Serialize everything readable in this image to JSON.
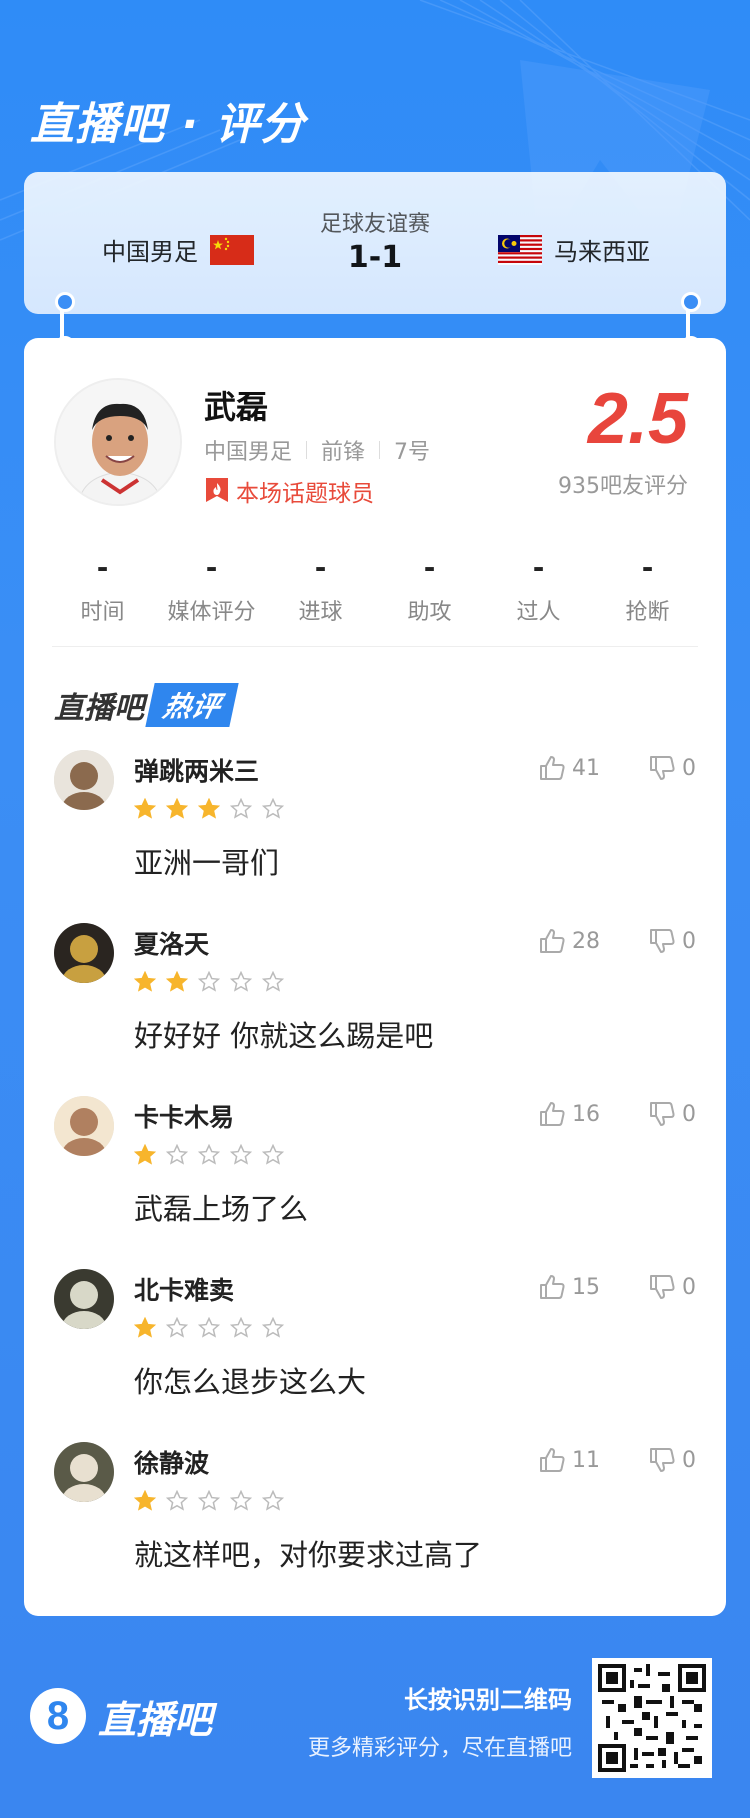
{
  "header": {
    "title": "直播吧 · 评分"
  },
  "match": {
    "home_team": "中国男足",
    "away_team": "马来西亚",
    "type": "足球友谊赛",
    "score": "1-1"
  },
  "player": {
    "name": "武磊",
    "team": "中国男足",
    "position": "前锋",
    "number": "7号",
    "badge": "本场话题球员",
    "rating": "2.5",
    "rating_count": "935吧友评分"
  },
  "stats": [
    {
      "label": "时间",
      "value": "-"
    },
    {
      "label": "媒体评分",
      "value": "-"
    },
    {
      "label": "进球",
      "value": "-"
    },
    {
      "label": "助攻",
      "value": "-"
    },
    {
      "label": "过人",
      "value": "-"
    },
    {
      "label": "抢断",
      "value": "-"
    }
  ],
  "hot_comments": {
    "title_part1": "直播吧",
    "title_part2": "热评",
    "items": [
      {
        "user": "弹跳两米三",
        "stars": 3,
        "text": "亚洲一哥们",
        "likes": "41",
        "dislikes": "0"
      },
      {
        "user": "夏洛天",
        "stars": 2,
        "text": "好好好 你就这么踢是吧",
        "likes": "28",
        "dislikes": "0"
      },
      {
        "user": "卡卡木易",
        "stars": 1,
        "text": "武磊上场了么",
        "likes": "16",
        "dislikes": "0"
      },
      {
        "user": "北卡难卖",
        "stars": 1,
        "text": "你怎么退步这么大",
        "likes": "15",
        "dislikes": "0"
      },
      {
        "user": "徐静波",
        "stars": 1,
        "text": "就这样吧，对你要求过高了",
        "likes": "11",
        "dislikes": "0"
      }
    ]
  },
  "footer": {
    "logo_number": "8",
    "logo_text": "直播吧",
    "qr_prompt": "长按识别二维码",
    "tagline": "更多精彩评分，尽在直播吧"
  },
  "colors": {
    "background": "#3b8ef5",
    "rating_red": "#e8453c",
    "star_gold": "#f7b52c",
    "hot_badge_red": "#e84a3a",
    "hot_title_blue": "#2f86ee"
  }
}
